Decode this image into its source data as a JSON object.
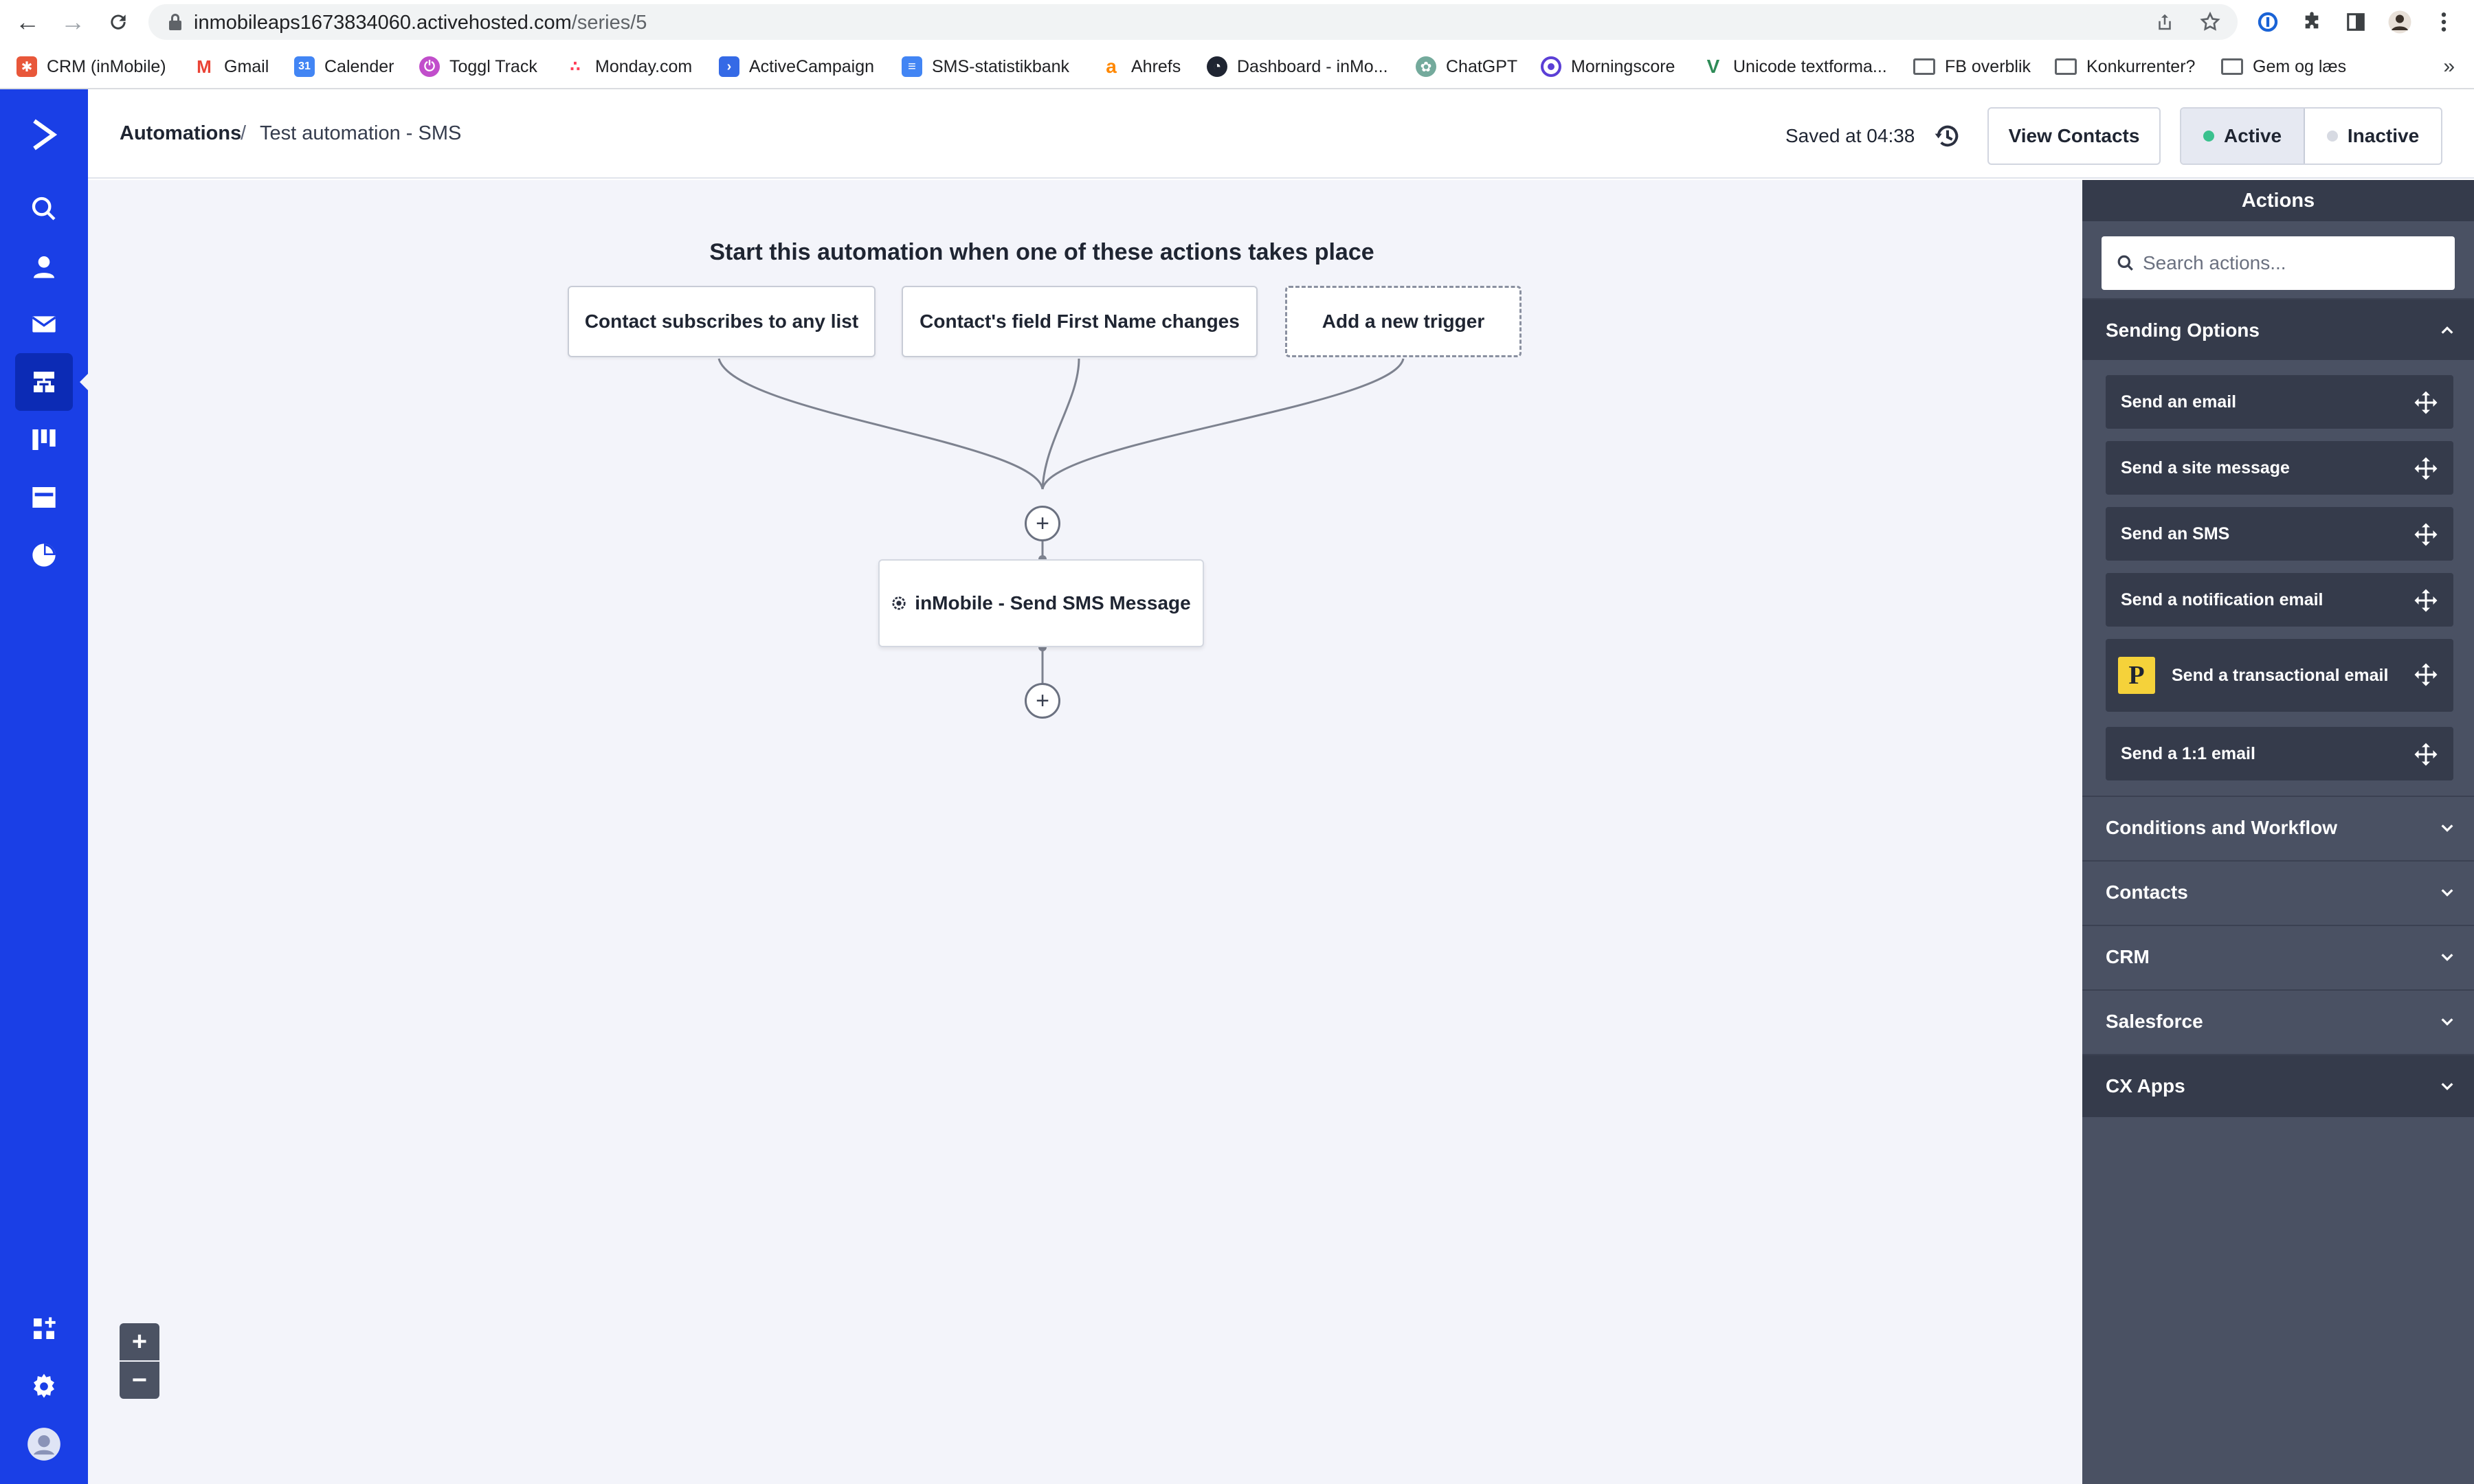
{
  "browser": {
    "url_host": "inmobileaps1673834060.activehosted.com",
    "url_path": "/series/5",
    "bookmarks": [
      {
        "label": "CRM (inMobile)",
        "color": "#e8573a"
      },
      {
        "label": "Gmail",
        "color": "#ea4335"
      },
      {
        "label": "Calender",
        "color": "#4285f4"
      },
      {
        "label": "Toggl Track",
        "color": "#c14ecb"
      },
      {
        "label": "Monday.com",
        "color": "#ff3d57"
      },
      {
        "label": "ActiveCampaign",
        "color": "#356ae6"
      },
      {
        "label": "SMS-statistikbank",
        "color": "#4285f4"
      },
      {
        "label": "Ahrefs",
        "color": "#ff8800"
      },
      {
        "label": "Dashboard - inMo...",
        "color": "#1f2532"
      },
      {
        "label": "ChatGPT",
        "color": "#74aa9c"
      },
      {
        "label": "Morningscore",
        "color": "#5b3fd6"
      },
      {
        "label": "Unicode textforma...",
        "color": "#2e8b57"
      },
      {
        "label": "FB overblik",
        "color": "folder"
      },
      {
        "label": "Konkurrenter?",
        "color": "folder"
      },
      {
        "label": "Gem og læs",
        "color": "folder"
      }
    ],
    "more_label": "»"
  },
  "header": {
    "breadcrumb_root": "Automations",
    "breadcrumb_sep": "/",
    "breadcrumb_leaf": "Test automation - SMS",
    "saved_text": "Saved at 04:38",
    "view_contacts_label": "View Contacts",
    "active_label": "Active",
    "inactive_label": "Inactive",
    "active_dot_color": "#3ac18e",
    "inactive_dot_color": "#d7dae2"
  },
  "canvas": {
    "title": "Start this automation when one of these actions takes place",
    "triggers": [
      {
        "label": "Contact subscribes to any list"
      },
      {
        "label": "Contact's field First Name changes"
      },
      {
        "label": "Add a new trigger"
      }
    ],
    "action_node_label": "inMobile - Send SMS Message",
    "plus_symbol": "+",
    "zoom_in": "+",
    "zoom_out": "−"
  },
  "panel": {
    "title": "Actions",
    "search_placeholder": "Search actions...",
    "sections": [
      {
        "label": "Sending Options",
        "expanded": true
      },
      {
        "label": "Conditions and Workflow",
        "expanded": false
      },
      {
        "label": "Contacts",
        "expanded": false
      },
      {
        "label": "CRM",
        "expanded": false
      },
      {
        "label": "Salesforce",
        "expanded": false
      },
      {
        "label": "CX Apps",
        "expanded": false
      }
    ],
    "sending_actions": [
      {
        "label": "Send an email"
      },
      {
        "label": "Send a site message"
      },
      {
        "label": "Send an SMS"
      },
      {
        "label": "Send a notification email"
      },
      {
        "label": "Send a transactional email",
        "badge": "P"
      },
      {
        "label": "Send a 1:1 email"
      }
    ]
  },
  "colors": {
    "nav_blue": "#1a3fe6",
    "panel_bg": "#4a5163",
    "panel_dark": "#353b4b",
    "canvas_bg": "#f3f4fa"
  }
}
